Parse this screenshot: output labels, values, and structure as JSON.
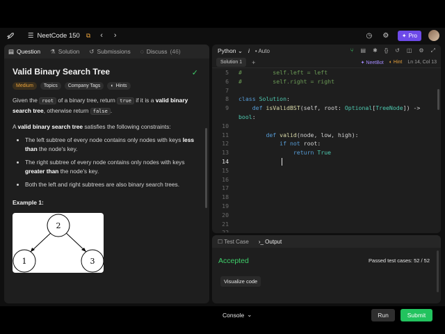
{
  "topbar": {
    "list_name": "NeetCode 150",
    "pro_label": "Pro"
  },
  "left_tabs": [
    {
      "label": "Question"
    },
    {
      "label": "Solution"
    },
    {
      "label": "Submissions"
    },
    {
      "label": "Discuss",
      "count": "(46)"
    }
  ],
  "question": {
    "title": "Valid Binary Search Tree",
    "tags": [
      "Medium",
      "Topics",
      "Company Tags",
      "Hints"
    ],
    "p1_a": "Given the ",
    "p1_code1": "root",
    "p1_b": " of a binary tree, return ",
    "p1_code2": "true",
    "p1_c": " if it is a ",
    "p1_bold": "valid binary search tree",
    "p1_d": ", otherwise return ",
    "p1_code3": "false",
    "p1_e": ".",
    "p2_a": "A ",
    "p2_bold": "valid binary search tree",
    "p2_b": " satisfies the following constraints:",
    "rule1_a": "The left subtree of every node contains only nodes with keys ",
    "rule1_bold": "less than",
    "rule1_b": " the node's key.",
    "rule2_a": "The right subtree of every node contains only nodes with keys ",
    "rule2_bold": "greater than",
    "rule2_b": " the node's key.",
    "rule3": "Both the left and right subtrees are also binary search trees.",
    "example_title": "Example 1:",
    "tree_nodes": [
      "2",
      "1",
      "3"
    ]
  },
  "editor": {
    "language": "Python",
    "info": "i",
    "auto_label": "Auto",
    "solution_tab": "Solution 1",
    "add_label": "+",
    "neetbot": "NeetBot",
    "hint": "Hint",
    "position": "Ln 14, Col 13",
    "lines": [
      {
        "n": "5",
        "text": "#         self.left = left"
      },
      {
        "n": "6",
        "text": "#         self.right = right"
      },
      {
        "n": "7",
        "text": ""
      },
      {
        "n": "8",
        "text": "class Solution:"
      },
      {
        "n": "9",
        "text": "    def isValidBST(self, root: Optional[TreeNode]) ->"
      },
      {
        "n": "",
        "text": "bool:"
      },
      {
        "n": "10",
        "text": ""
      },
      {
        "n": "11",
        "text": "        def valid(node, low, high):"
      },
      {
        "n": "12",
        "text": "            if not root:"
      },
      {
        "n": "13",
        "text": "                return True"
      },
      {
        "n": "14",
        "text": ""
      },
      {
        "n": "15",
        "text": ""
      },
      {
        "n": "16",
        "text": ""
      },
      {
        "n": "17",
        "text": ""
      },
      {
        "n": "18",
        "text": ""
      },
      {
        "n": "19",
        "text": ""
      },
      {
        "n": "20",
        "text": ""
      },
      {
        "n": "21",
        "text": ""
      },
      {
        "n": "22",
        "text": ""
      }
    ]
  },
  "output": {
    "tabs": [
      "Test Case",
      "Output"
    ],
    "status": "Accepted",
    "passed": "Passed test cases: 52 / 52",
    "visualize": "Visualize code"
  },
  "actions": {
    "console": "Console",
    "run": "Run",
    "submit": "Submit"
  },
  "colors": {
    "accent_green": "#22c35e",
    "pro_purple": "#6d4ae8",
    "medium_orange": "#e7a13b"
  }
}
